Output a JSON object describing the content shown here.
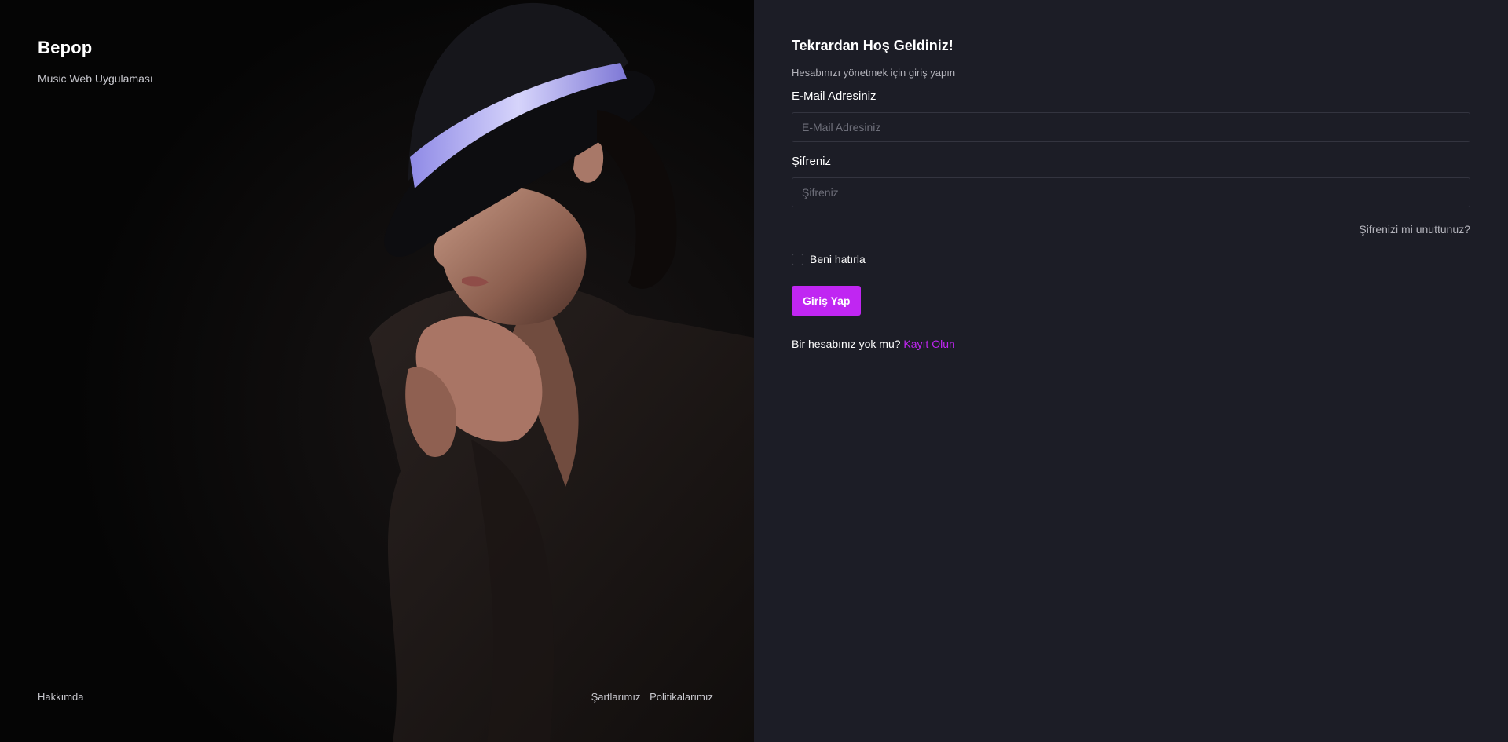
{
  "brand": {
    "title": "Bepop",
    "subtitle": "Music Web Uygulaması"
  },
  "hero_image": {
    "description": "woman-in-black-fedora-photo"
  },
  "left_footer": {
    "about": "Hakkımda",
    "terms": "Şartlarımız",
    "policies": "Politikalarımız"
  },
  "login": {
    "title": "Tekrardan Hoş Geldiniz!",
    "subtitle": "Hesabınızı yönetmek için giriş yapın",
    "email_label": "E-Mail Adresiniz",
    "email_placeholder": "E-Mail Adresiniz",
    "email_value": "",
    "password_label": "Şifreniz",
    "password_placeholder": "Şifreniz",
    "password_value": "",
    "forgot_label": "Şifrenizi mi unuttunuz?",
    "remember_label": "Beni hatırla",
    "remember_checked": false,
    "submit_label": "Giriş Yap",
    "no_account_text": "Bir hesabınız yok mu?",
    "signup_label": "Kayıt Olun"
  },
  "colors": {
    "accent": "#c026f2",
    "panel_bg": "#1c1d26",
    "left_bg": "#050505",
    "hat_band": "#a7a3f2"
  }
}
